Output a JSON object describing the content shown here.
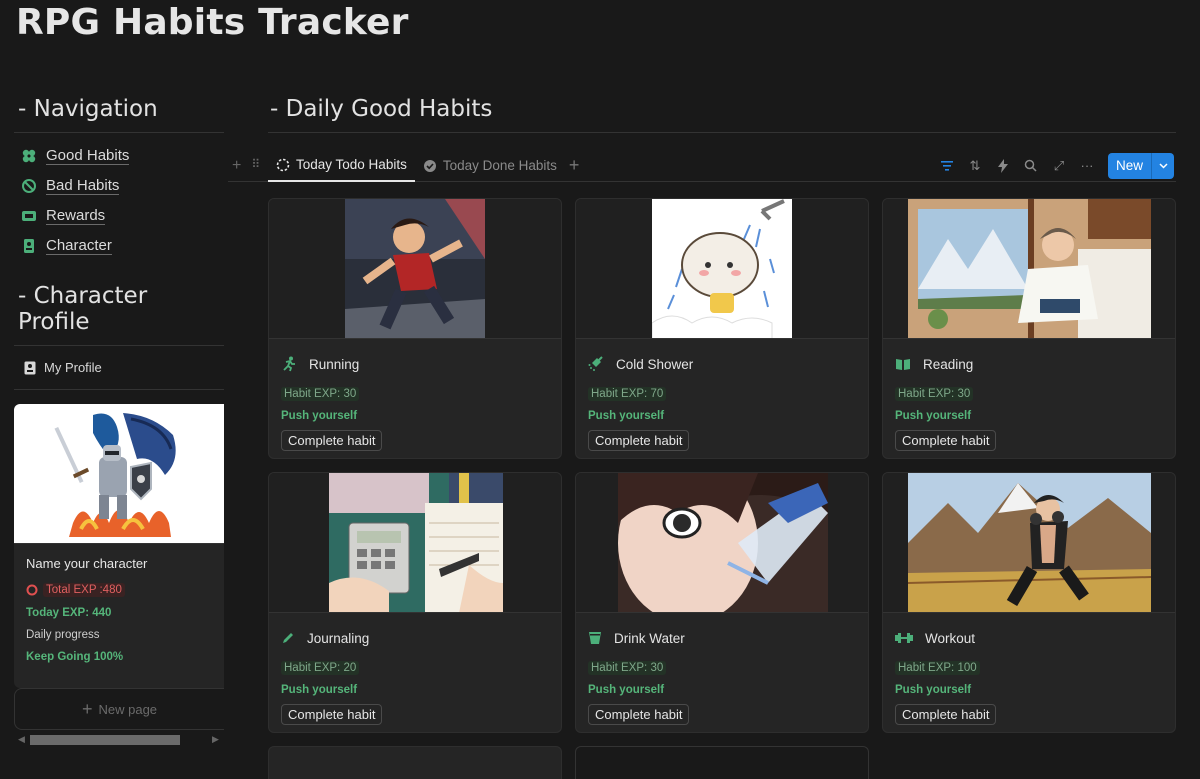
{
  "page": {
    "title": "RPG Habits Tracker"
  },
  "navigation": {
    "heading": "- Navigation",
    "items": [
      {
        "label": "Good Habits",
        "icon": "clover-icon"
      },
      {
        "label": "Bad Habits",
        "icon": "prohibited-icon"
      },
      {
        "label": "Rewards",
        "icon": "ticket-icon"
      },
      {
        "label": "Character",
        "icon": "id-badge-icon"
      }
    ]
  },
  "character_profile": {
    "heading": "- Character Profile",
    "link_label": "My Profile",
    "card": {
      "name": "Name your character",
      "total_exp": "Total EXP :480",
      "today_exp": "Today EXP: 440",
      "daily_progress_label": "Daily progress",
      "keep_going": "Keep Going 100%"
    }
  },
  "new_page": {
    "label": "New page"
  },
  "main": {
    "heading": "- Daily Good Habits",
    "tabs": [
      {
        "label": "Today Todo Habits",
        "active": true
      },
      {
        "label": "Today Done Habits",
        "active": false
      }
    ],
    "new_button": "New",
    "accent": "#2383e2",
    "cards": [
      {
        "title": "Running",
        "icon": "running-icon",
        "exp": "Habit EXP: 30",
        "push": "Push yourself",
        "action": "Complete habit"
      },
      {
        "title": "Cold Shower",
        "icon": "shower-icon",
        "exp": "Habit EXP: 70",
        "push": "Push yourself",
        "action": "Complete habit"
      },
      {
        "title": "Reading",
        "icon": "book-icon",
        "exp": "Habit EXP: 30",
        "push": "Push yourself",
        "action": "Complete habit"
      },
      {
        "title": "Journaling",
        "icon": "pencil-icon",
        "exp": "Habit EXP: 20",
        "push": "Push yourself",
        "action": "Complete habit"
      },
      {
        "title": "Drink Water",
        "icon": "cup-icon",
        "exp": "Habit EXP: 30",
        "push": "Push yourself",
        "action": "Complete habit"
      },
      {
        "title": "Workout",
        "icon": "dumbbell-icon",
        "exp": "Habit EXP: 100",
        "push": "Push yourself",
        "action": "Complete habit"
      }
    ]
  }
}
